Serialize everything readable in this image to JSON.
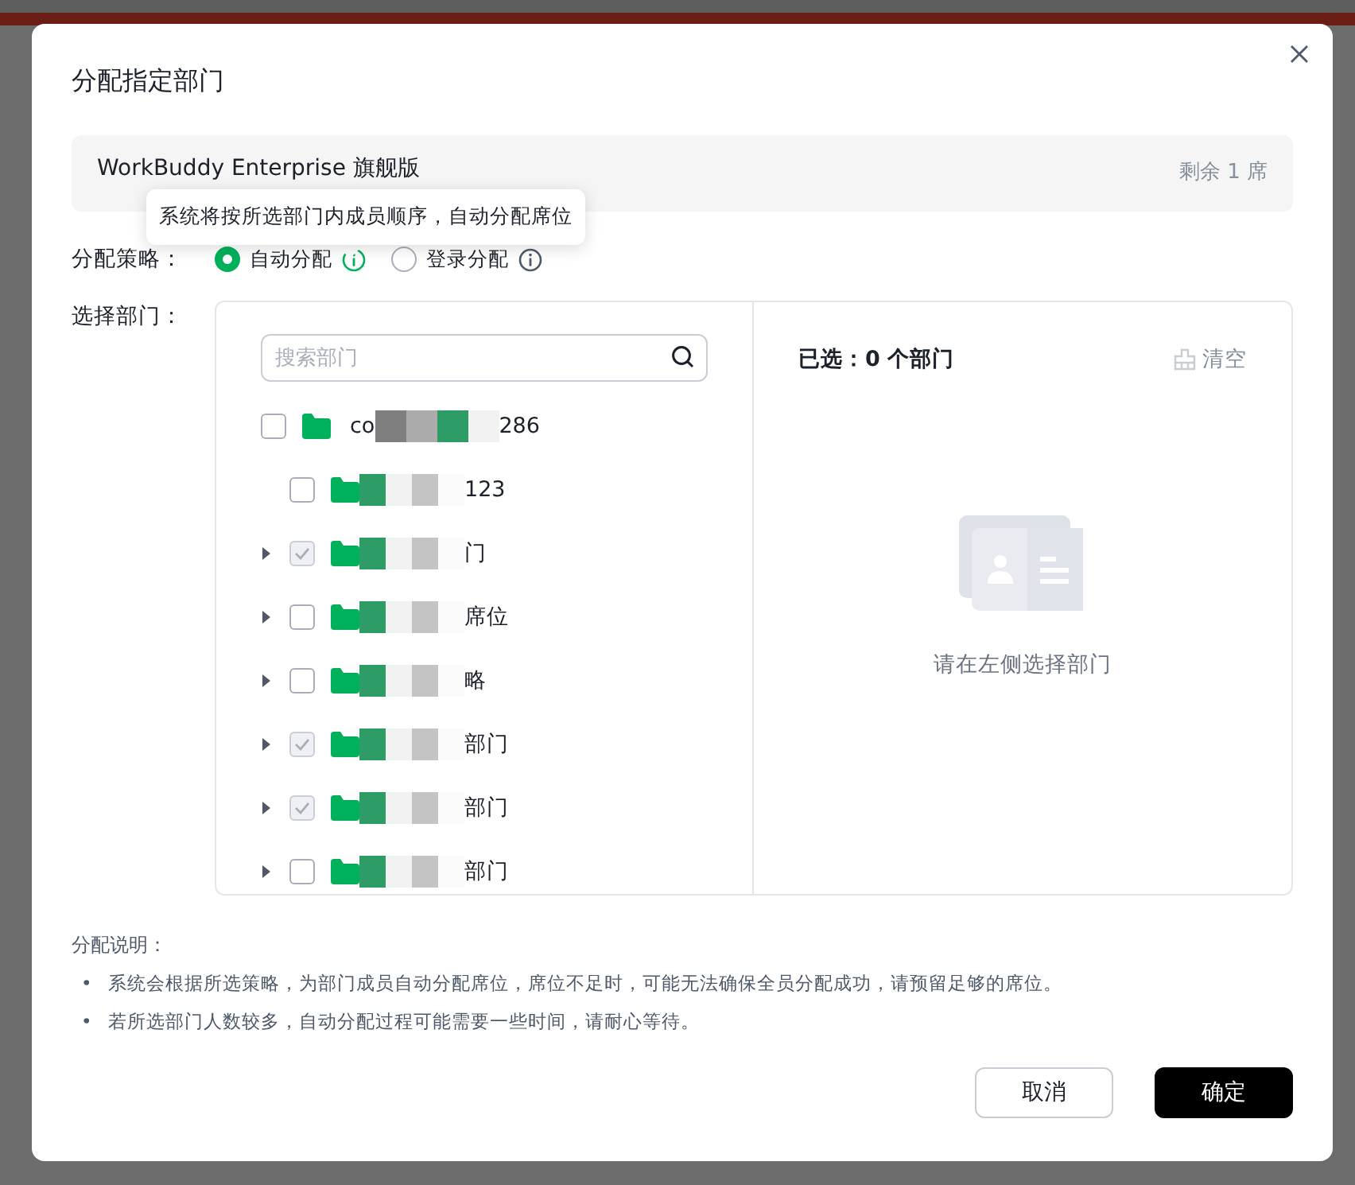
{
  "dialog": {
    "title": "分配指定部门"
  },
  "plan": {
    "name": "WorkBuddy Enterprise 旗舰版",
    "remaining": "剩余 1 席"
  },
  "tooltip": "系统将按所选部门内成员顺序，自动分配席位",
  "strategy": {
    "label": "分配策略：",
    "options": [
      {
        "label": "自动分配",
        "selected": true
      },
      {
        "label": "登录分配",
        "selected": false
      }
    ]
  },
  "departments": {
    "label": "选择部门：",
    "search": {
      "placeholder": "搜索部门"
    },
    "tree": [
      {
        "prefix": "co",
        "suffix": "286",
        "redacted": true,
        "checked": false,
        "expandable": false,
        "children": [
          {
            "suffix": "123",
            "redacted": true,
            "checked": false,
            "expandable": false
          },
          {
            "suffix": "门",
            "redacted": true,
            "checked": true,
            "expandable": true
          },
          {
            "suffix": "席位",
            "redacted": true,
            "checked": false,
            "expandable": true
          },
          {
            "suffix": "略",
            "redacted": true,
            "checked": false,
            "expandable": true
          },
          {
            "suffix": "部门",
            "redacted": true,
            "checked": true,
            "expandable": true
          },
          {
            "suffix": "部门",
            "redacted": true,
            "checked": true,
            "expandable": true
          },
          {
            "suffix": "部门",
            "redacted": true,
            "checked": false,
            "expandable": true
          }
        ]
      }
    ],
    "selected_count": "已选：0 个部门",
    "clear": "清空",
    "empty": "请在左侧选择部门"
  },
  "notes": {
    "title": "分配说明：",
    "items": [
      {
        "bullet": "•",
        "text": "系统会根据所选策略，为部门成员自动分配席位，席位不足时，可能无法确保全员分配成功，请预留足够的席位。"
      },
      {
        "bullet": "•",
        "text": "若所选部门人数较多，自动分配过程可能需要一些时间，请耐心等待。"
      }
    ]
  },
  "buttons": [
    {
      "label": "取消",
      "kind": "secondary"
    },
    {
      "label": "确定",
      "kind": "primary"
    }
  ]
}
